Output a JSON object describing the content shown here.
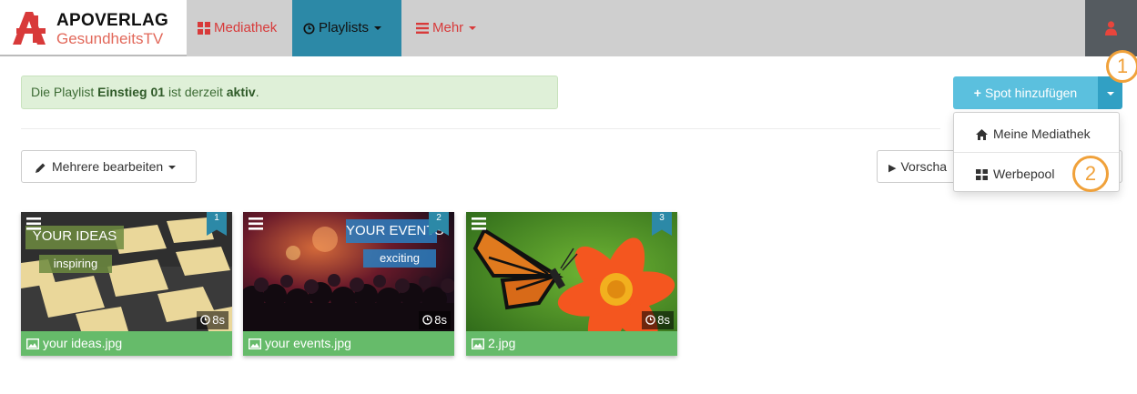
{
  "brand": {
    "title": "APOVERLAG",
    "subtitle": "GesundheitsTV"
  },
  "nav": [
    {
      "label": "Mediathek",
      "icon": "th-large-icon",
      "active": false
    },
    {
      "label": "Playlists",
      "icon": "clock-icon",
      "active": true
    },
    {
      "label": "Mehr",
      "icon": "list-icon",
      "active": false
    }
  ],
  "alert": {
    "prefix": "Die Playlist ",
    "playlist": "Einstieg 01",
    "middle": " ist derzeit ",
    "status": "aktiv",
    "suffix": "."
  },
  "toolbar": {
    "edit_multiple": "Mehrere bearbeiten",
    "preview": "Vorscha",
    "add_spot": "Spot hinzufügen"
  },
  "dropdown": {
    "items": [
      "Meine Mediathek",
      "Werbepool"
    ]
  },
  "callouts": [
    "1",
    "2"
  ],
  "cards": [
    {
      "position": "1",
      "duration": "8s",
      "filename": "your ideas.jpg",
      "overlay_title": "YOUR IDEAS",
      "overlay_sub": "inspiring"
    },
    {
      "position": "2",
      "duration": "8s",
      "filename": "your events.jpg",
      "overlay_title": "YOUR EVENTS",
      "overlay_sub": "exciting"
    },
    {
      "position": "3",
      "duration": "8s",
      "filename": "2.jpg"
    }
  ],
  "colors": {
    "nav_bg": "#cfcfcf",
    "nav_active": "#2c89a7",
    "accent_red": "#d83a3a",
    "info_button": "#5bc0de",
    "card_caption": "#66bb6a",
    "callout": "#f0a13a"
  }
}
